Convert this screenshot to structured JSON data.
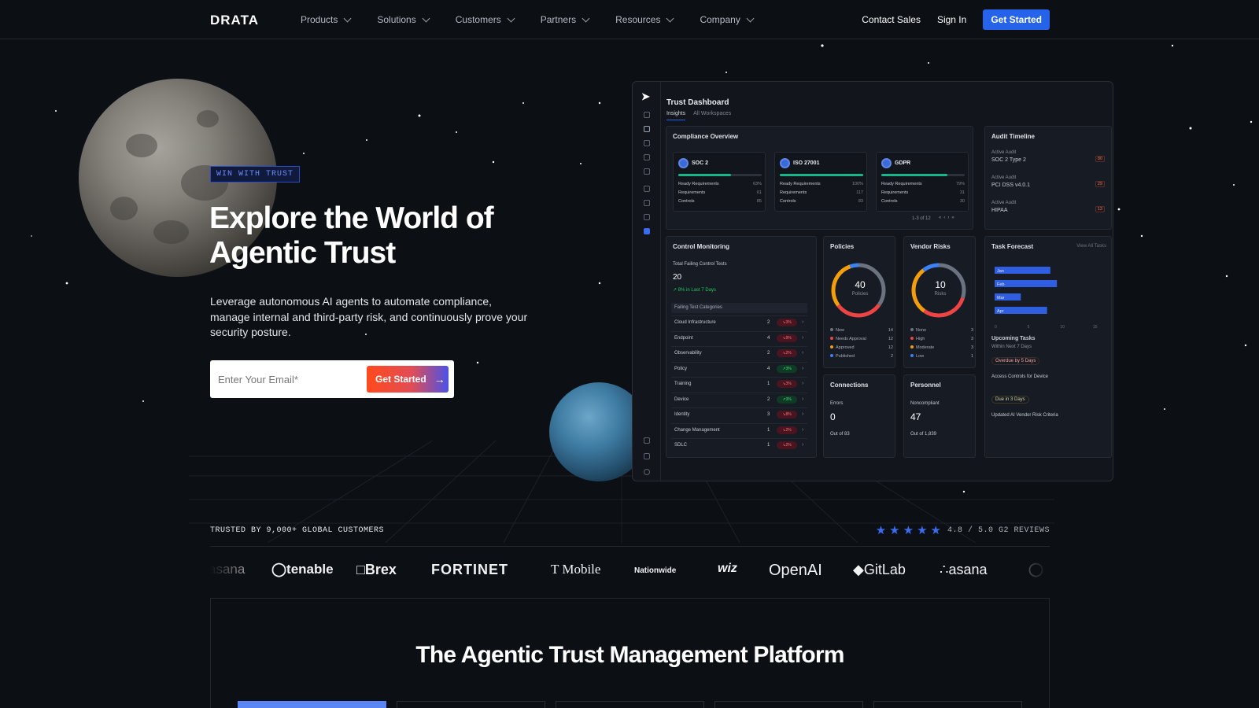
{
  "nav": {
    "logo": "DRATA",
    "menu": [
      "Products",
      "Solutions",
      "Customers",
      "Partners",
      "Resources",
      "Company"
    ],
    "contact": "Contact Sales",
    "signin": "Sign In",
    "cta": "Get Started"
  },
  "hero": {
    "badge": "WIN WITH TRUST",
    "title": "Explore the World of Agentic Trust",
    "subtitle": "Leverage autonomous AI agents to automate compliance, manage internal and third-party risk, and continuously prove your security posture.",
    "email_placeholder": "Enter Your Email*",
    "button": "Get Started"
  },
  "dashboard": {
    "title": "Trust Dashboard",
    "tabs": [
      "Insights",
      "All Workspaces"
    ],
    "compliance": {
      "title": "Compliance Overview",
      "frameworks": [
        {
          "name": "SOC 2",
          "progress": 63,
          "rows": [
            [
              "Ready Requirements",
              "63%"
            ],
            [
              "Requirements",
              "61"
            ],
            [
              "Controls",
              "85"
            ]
          ]
        },
        {
          "name": "ISO 27001",
          "progress": 100,
          "rows": [
            [
              "Ready Requirements",
              "100%"
            ],
            [
              "Requirements",
              "117"
            ],
            [
              "Controls",
              "83"
            ]
          ]
        },
        {
          "name": "GDPR",
          "progress": 79,
          "rows": [
            [
              "Ready Requirements",
              "79%"
            ],
            [
              "Requirements",
              "31"
            ],
            [
              "Controls",
              "30"
            ]
          ]
        }
      ],
      "pagination": "1-3 of 12"
    },
    "audit": {
      "title": "Audit Timeline",
      "items": [
        {
          "label": "Active Audit",
          "name": "SOC 2 Type 2",
          "pill": "80"
        },
        {
          "label": "Active Audit",
          "name": "PCI DSS v4.0.1",
          "pill": "29"
        },
        {
          "label": "Active Audit",
          "name": "HIPAA",
          "pill": "13"
        }
      ]
    },
    "control": {
      "title": "Control Monitoring",
      "subtitle": "Total Failing Control Tests",
      "value": "20",
      "delta": "8% in Last 7 Days",
      "categories_title": "Failing Test Categories",
      "rows": [
        {
          "name": "Cloud Infrastructure",
          "count": "2",
          "pct": "3%",
          "dir": "down"
        },
        {
          "name": "Endpoint",
          "count": "4",
          "pct": "9%",
          "dir": "down"
        },
        {
          "name": "Observability",
          "count": "2",
          "pct": "2%",
          "dir": "down"
        },
        {
          "name": "Policy",
          "count": "4",
          "pct": "3%",
          "dir": "up"
        },
        {
          "name": "Training",
          "count": "1",
          "pct": "3%",
          "dir": "down"
        },
        {
          "name": "Device",
          "count": "2",
          "pct": "3%",
          "dir": "up"
        },
        {
          "name": "Identity",
          "count": "3",
          "pct": "8%",
          "dir": "down"
        },
        {
          "name": "Change Management",
          "count": "1",
          "pct": "2%",
          "dir": "down"
        },
        {
          "name": "SDLC",
          "count": "1",
          "pct": "2%",
          "dir": "down"
        }
      ]
    },
    "policies": {
      "title": "Policies",
      "value": "40",
      "label": "Policies",
      "legend": [
        [
          "New",
          "14",
          "#6b7280"
        ],
        [
          "Needs Approval",
          "12",
          "#ef4444"
        ],
        [
          "Approved",
          "12",
          "#f59e0b"
        ],
        [
          "Published",
          "2",
          "#3b82f6"
        ]
      ]
    },
    "vendor": {
      "title": "Vendor Risks",
      "value": "10",
      "label": "Risks",
      "legend": [
        [
          "None",
          "3",
          "#6b7280"
        ],
        [
          "High",
          "3",
          "#ef4444"
        ],
        [
          "Moderate",
          "3",
          "#f59e0b"
        ],
        [
          "Low",
          "1",
          "#3b82f6"
        ]
      ]
    },
    "forecast": {
      "title": "Task Forecast",
      "link": "View All Tasks",
      "months": [
        "Jan",
        "Feb",
        "Mar",
        "Apr"
      ],
      "values": [
        8.5,
        9.5,
        4.0,
        8.0
      ],
      "ticks": [
        "0",
        "5",
        "10",
        "15"
      ],
      "upcoming_title": "Upcoming Tasks",
      "upcoming_sub": "Within Next 7 Days",
      "tasks": [
        {
          "pill": "Overdue by 5 Days",
          "name": "Access Controls for Device"
        },
        {
          "pill": "Due in 3 Days",
          "name": "Updated AI Vendor Risk Criteria"
        }
      ]
    },
    "connections": {
      "title": "Connections",
      "label": "Errors",
      "value": "0",
      "sub": "Out of 83"
    },
    "personnel": {
      "title": "Personnel",
      "label": "Noncompliant",
      "value": "47",
      "sub": "Out of 1,839"
    }
  },
  "trusted": {
    "text": "TRUSTED BY 9,000+ GLOBAL CUSTOMERS",
    "stars": 5,
    "rating": "4.8 / 5.0 G2 REVIEWS"
  },
  "logos": [
    "asana",
    "tenable",
    "Brex",
    "FORTINET",
    "T Mobile",
    "Nationwide",
    "wiz",
    "OpenAI",
    "GitLab",
    "asana"
  ],
  "platform": {
    "title": "The Agentic Trust Management Platform"
  },
  "colors": {
    "background": "#0c0f14",
    "accent": "#2563eb",
    "badge": "#6f8cff"
  }
}
